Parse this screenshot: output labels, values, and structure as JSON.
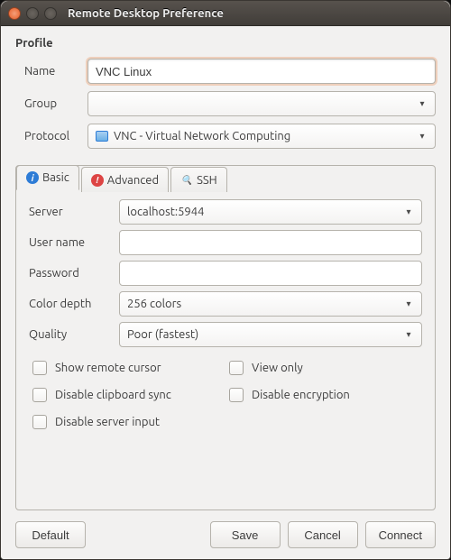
{
  "window": {
    "title": "Remote Desktop Preference"
  },
  "profile": {
    "heading": "Profile",
    "name_label": "Name",
    "name_value": "VNC Linux",
    "group_label": "Group",
    "group_value": "",
    "protocol_label": "Protocol",
    "protocol_value": "VNC - Virtual Network Computing"
  },
  "tabs": {
    "basic": "Basic",
    "advanced": "Advanced",
    "ssh": "SSH"
  },
  "basic": {
    "server_label": "Server",
    "server_value": "localhost:5944",
    "username_label": "User name",
    "username_value": "",
    "password_label": "Password",
    "password_value": "",
    "colordepth_label": "Color depth",
    "colordepth_value": "256 colors",
    "quality_label": "Quality",
    "quality_value": "Poor (fastest)",
    "checks": {
      "show_remote_cursor": "Show remote cursor",
      "view_only": "View only",
      "disable_clipboard_sync": "Disable clipboard sync",
      "disable_encryption": "Disable encryption",
      "disable_server_input": "Disable server input"
    }
  },
  "buttons": {
    "default": "Default",
    "save": "Save",
    "cancel": "Cancel",
    "connect": "Connect"
  }
}
